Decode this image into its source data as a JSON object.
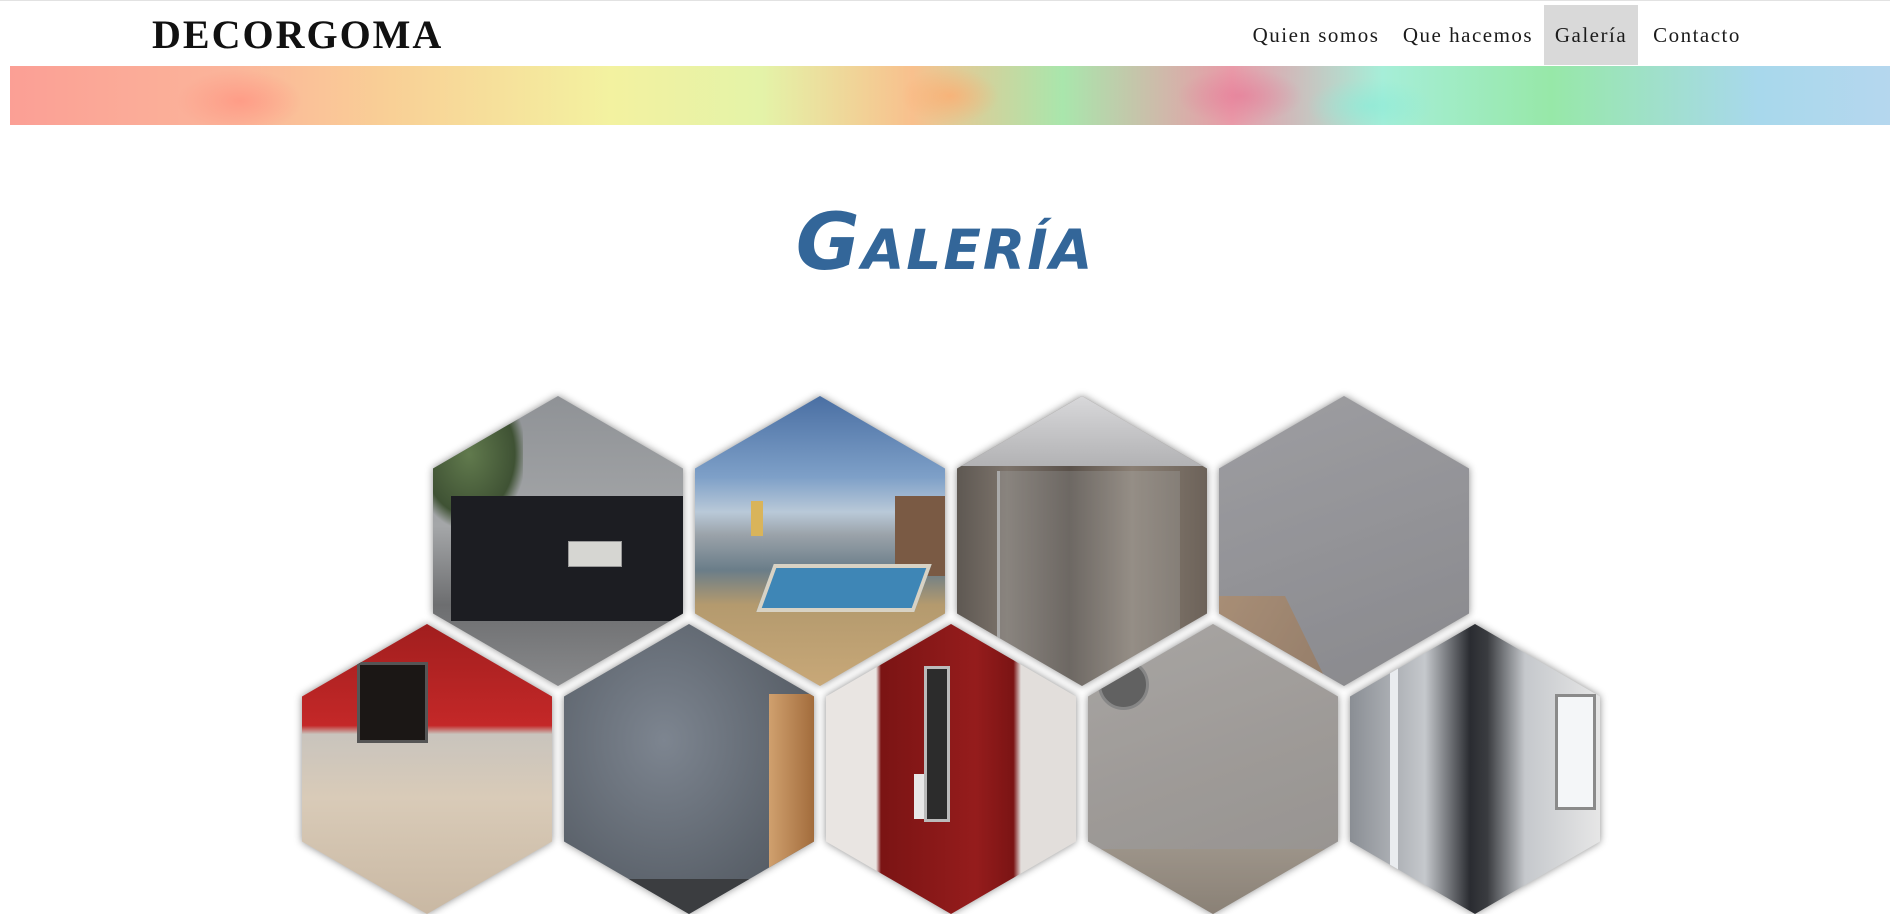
{
  "header": {
    "brand": "DECORGOMA",
    "nav": [
      {
        "label": "Quien somos",
        "active": false
      },
      {
        "label": "Que hacemos",
        "active": false
      },
      {
        "label": "Galería",
        "active": true
      },
      {
        "label": "Contacto",
        "active": false
      }
    ],
    "active_nav_bg": "#d9d9d9"
  },
  "page": {
    "title": "Galería",
    "title_color": "#336699"
  },
  "gallery": {
    "items": [
      {
        "name": "gallery-photo-gate"
      },
      {
        "name": "gallery-photo-rooftop-pool"
      },
      {
        "name": "gallery-photo-shower"
      },
      {
        "name": "gallery-photo-plain-wall"
      },
      {
        "name": "gallery-photo-red-kitchen"
      },
      {
        "name": "gallery-photo-textured-wall"
      },
      {
        "name": "gallery-photo-red-door"
      },
      {
        "name": "gallery-photo-speckled-wall"
      },
      {
        "name": "gallery-photo-corridor"
      }
    ]
  }
}
